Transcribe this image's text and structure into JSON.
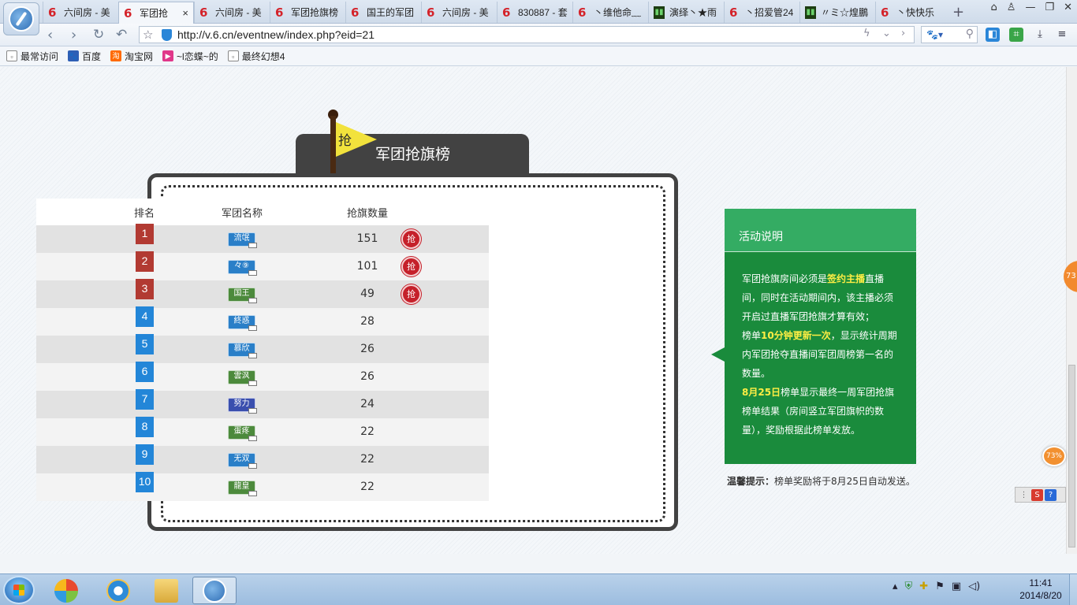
{
  "browser": {
    "tabs": [
      {
        "title": "六间房 - 美",
        "icon": "six-rooms-icon",
        "active": false
      },
      {
        "title": "军团抢",
        "icon": "six-rooms-icon",
        "active": true
      },
      {
        "title": "六间房 - 美",
        "icon": "six-rooms-icon",
        "active": false
      },
      {
        "title": "军团抢旗榜",
        "icon": "six-rooms-icon",
        "active": false
      },
      {
        "title": "国王的军团",
        "icon": "six-rooms-icon",
        "active": false
      },
      {
        "title": "六间房 - 美",
        "icon": "six-rooms-icon",
        "active": false
      },
      {
        "title": "830887 - 套",
        "icon": "six-rooms-icon",
        "active": false
      },
      {
        "title": "丶维他命﹏",
        "icon": "six-rooms-icon",
        "active": false
      },
      {
        "title": "演绎丶★雨",
        "icon": "stats-icon",
        "active": false
      },
      {
        "title": "丶招爱管24",
        "icon": "six-rooms-icon",
        "active": false
      },
      {
        "title": "〃ミ☆煌鵬",
        "icon": "stats-icon",
        "active": false
      },
      {
        "title": "丶快快乐",
        "icon": "six-rooms-icon",
        "active": false
      }
    ],
    "close_glyph": "×",
    "new_tab_glyph": "+",
    "url": "http://v.6.cn/eventnew/index.php?eid=21",
    "bookmarks": [
      {
        "label": "最常访问",
        "icon": "page-icon",
        "color": "#ffffff"
      },
      {
        "label": "百度",
        "icon": "baidu-paw-icon",
        "color": "#2e5fb5"
      },
      {
        "label": "淘宝网",
        "icon": "taobao-icon",
        "color": "#ff6a00"
      },
      {
        "label": "~l恋蝶~的",
        "icon": "play-icon",
        "color": "#e0378a"
      },
      {
        "label": "最终幻想4",
        "icon": "page-icon",
        "color": "#ffffff"
      }
    ]
  },
  "leaderboard": {
    "flag_char": "抢",
    "title": "军团抢旗榜",
    "headers": {
      "rank": "排名",
      "legion": "军团名称",
      "count": "抢旗数量"
    },
    "grab_label": "抢",
    "rows": [
      {
        "rank": "1",
        "legion": "流氓",
        "count": "151",
        "top": true,
        "badge_color": "#2a7fc8"
      },
      {
        "rank": "2",
        "legion": "々⑨",
        "count": "101",
        "top": true,
        "badge_color": "#2a7fc8"
      },
      {
        "rank": "3",
        "legion": "国王",
        "count": "49",
        "top": true,
        "badge_color": "#4c8a3c"
      },
      {
        "rank": "4",
        "legion": "終惑",
        "count": "28",
        "top": false,
        "badge_color": "#2a7fc8"
      },
      {
        "rank": "5",
        "legion": "慕欣",
        "count": "26",
        "top": false,
        "badge_color": "#2a7fc8"
      },
      {
        "rank": "6",
        "legion": "雲沨",
        "count": "26",
        "top": false,
        "badge_color": "#4c8a3c"
      },
      {
        "rank": "7",
        "legion": "努力",
        "count": "24",
        "top": false,
        "badge_color": "#3a4fae"
      },
      {
        "rank": "8",
        "legion": "蛋疼",
        "count": "22",
        "top": false,
        "badge_color": "#4c8a3c"
      },
      {
        "rank": "9",
        "legion": "无双",
        "count": "22",
        "top": false,
        "badge_color": "#2a7fc8"
      },
      {
        "rank": "10",
        "legion": "龍皇",
        "count": "22",
        "top": false,
        "badge_color": "#4c8a3c"
      }
    ]
  },
  "info": {
    "title": "活动说明",
    "p1_a": "军团抢旗房间必须是",
    "p1_hl": "签约主播",
    "p1_b": "直播间，同时在活动期间内，该主播必须开启过直播军团抢旗才算有效；",
    "p2_a": "榜单",
    "p2_hl": "10分钟更新一次",
    "p2_b": "，显示统计周期内军团抢夺直播间军团周榜第一名的数量。",
    "p3_hl": "8月25日",
    "p3_b": "榜单显示最终一周军团抢旗榜单结果（房间竖立军团旗帜的数量），奖励根据此榜单发放。",
    "tip_label": "温馨提示：",
    "tip_text": "榜单奖励将于8月25日自动发送。"
  },
  "overlays": {
    "side_badge": "73",
    "speed_badge": "73%"
  },
  "taskbar": {
    "apps": [
      "windows-media-icon",
      "ie-icon",
      "explorer-folder-icon",
      "browser-360-icon"
    ],
    "time": "11:41",
    "date": "2014/8/20"
  }
}
